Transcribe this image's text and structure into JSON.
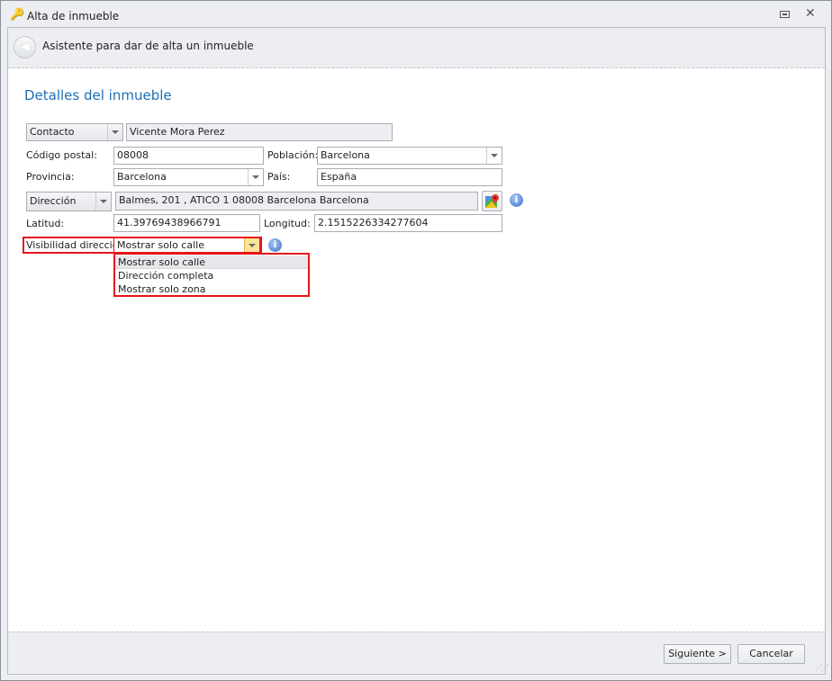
{
  "window": {
    "title": "Alta de inmueble"
  },
  "header": {
    "title": "Asistente para dar de alta un inmueble"
  },
  "section_title": "Detalles del inmueble",
  "form": {
    "contact_type": "Contacto",
    "contact_value": "Vicente Mora Perez",
    "postal_code_label": "Código postal:",
    "postal_code": "08008",
    "city_label": "Población:",
    "city": "Barcelona",
    "province_label": "Provincia:",
    "province": "Barcelona",
    "country_label": "País:",
    "country": "España",
    "address_type": "Dirección",
    "address": "Balmes, 201 , ATICO 1 08008 Barcelona Barcelona",
    "latitude_label": "Latitud:",
    "latitude": "41.39769438966791",
    "longitude_label": "Longitud:",
    "longitude": "2.1515226334277604",
    "visibility_label": "Visibilidad dirección:",
    "visibility": "Mostrar solo calle",
    "visibility_options": [
      "Mostrar solo calle",
      "Dirección completa",
      "Mostrar solo zona"
    ],
    "info_glyph": "i"
  },
  "footer": {
    "next_label": "Siguiente >",
    "cancel_label": "Cancelar"
  }
}
